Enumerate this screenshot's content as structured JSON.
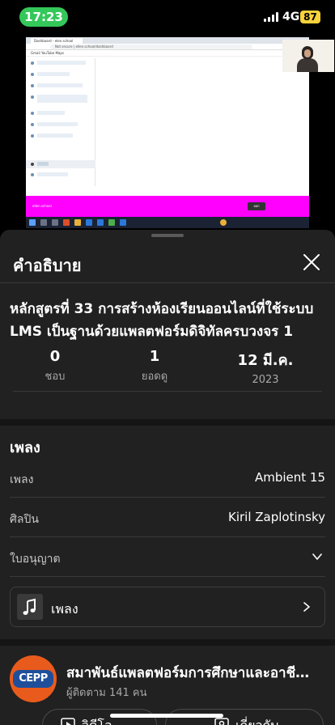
{
  "status_bar": {
    "time": "17:23",
    "network": "4G",
    "battery": "87"
  },
  "video_frame": {
    "browser_tab": "Dashboard - elen.school",
    "browser_url": "Not secure | ellen.school/dashboard",
    "bookmarks": "Gmail  YouTube  Maps",
    "magenta_label": "ellen.school",
    "magenta_button": "ออก"
  },
  "sheet": {
    "title": "คำอธิบาย",
    "video_title": "หลักสูตรที่ 33 การสร้างห้องเรียนออนไลน์ที่ใช้ระบบ LMS เป็นฐานด้วยแพลตฟอร์มดิจิทัลครบวงจร 1",
    "stats": [
      {
        "value": "0",
        "label": "ชอบ"
      },
      {
        "value": "1",
        "label": "ยอดดู"
      },
      {
        "value": "12 มี.ค.",
        "label": "2023"
      }
    ],
    "music": {
      "heading": "เพลง",
      "song_label": "เพลง",
      "song_value": "Ambient 15",
      "artist_label": "ศิลปิน",
      "artist_value": "Kiril Zaplotinsky",
      "license_label": "ใบอนุญาต",
      "card_label": "เพลง"
    },
    "channel": {
      "logo_text": "CEPP",
      "name": "สมาพันธ์แพลตฟอร์มการศึกษาและอาชีพ...",
      "subscribers": "ผู้ติดตาม 141 คน",
      "videos_button": "วิดีโอ",
      "about_button": "เกี่ยวกับ"
    }
  },
  "colors": {
    "sheet_bg": "#212121",
    "status_pill": "#34c759",
    "battery": "#f7d23b",
    "magenta": "#ff00ff",
    "logo_orange": "#e95b1c",
    "logo_blue": "#1f4f9a"
  }
}
